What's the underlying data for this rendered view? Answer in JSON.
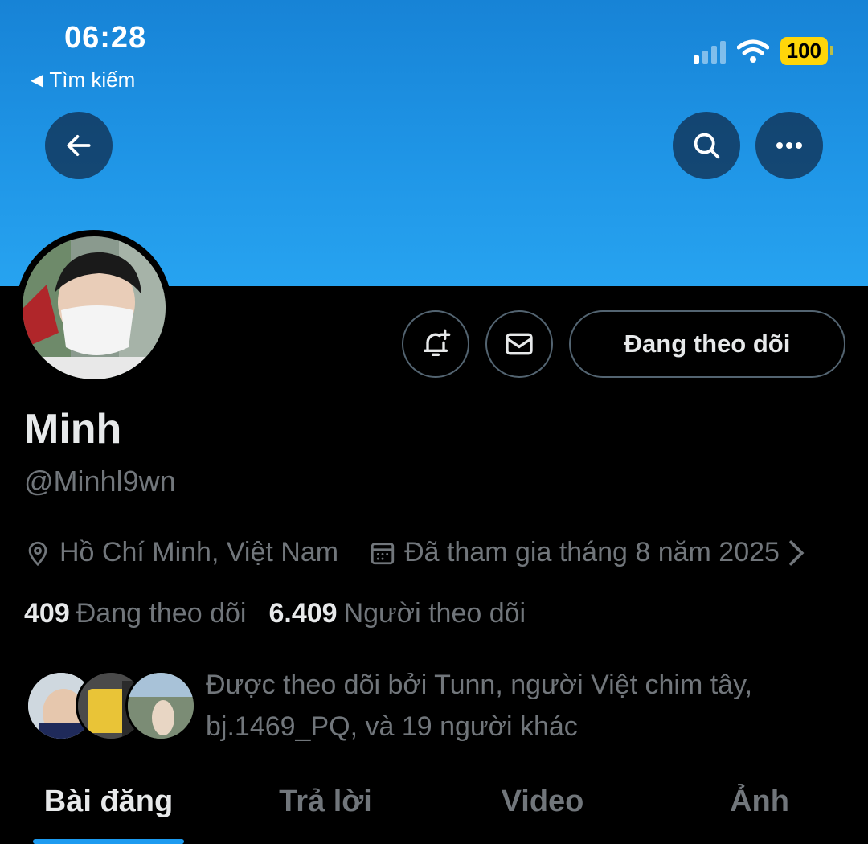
{
  "status_bar": {
    "time": "06:28",
    "back_app": "Tìm kiếm",
    "battery": "100",
    "battery_color": "#ffd60a"
  },
  "header": {
    "banner_color": "#1d9bf0",
    "back_icon": "arrow-left-icon",
    "search_icon": "search-icon",
    "more_icon": "more-horizontal-icon"
  },
  "actions": {
    "notify_icon": "bell-plus-icon",
    "message_icon": "envelope-icon",
    "follow_label": "Đang theo dõi"
  },
  "profile": {
    "name": "Minh",
    "handle": "@Minhl9wn",
    "location": "Hồ Chí Minh, Việt Nam",
    "joined": "Đã tham gia tháng 8 năm 2025",
    "following_count": "409",
    "following_label": "Đang theo dõi",
    "followers_count": "6.409",
    "followers_label": "Người theo dõi",
    "followed_by": "Được theo dõi bởi Tunn, người Việt chim tây, bj.1469_PQ, và 19 người khác"
  },
  "tabs": [
    {
      "label": "Bài đăng",
      "active": true
    },
    {
      "label": "Trả lời",
      "active": false
    },
    {
      "label": "Video",
      "active": false
    },
    {
      "label": "Ảnh",
      "active": false
    }
  ],
  "accent_color": "#1d9bf0"
}
